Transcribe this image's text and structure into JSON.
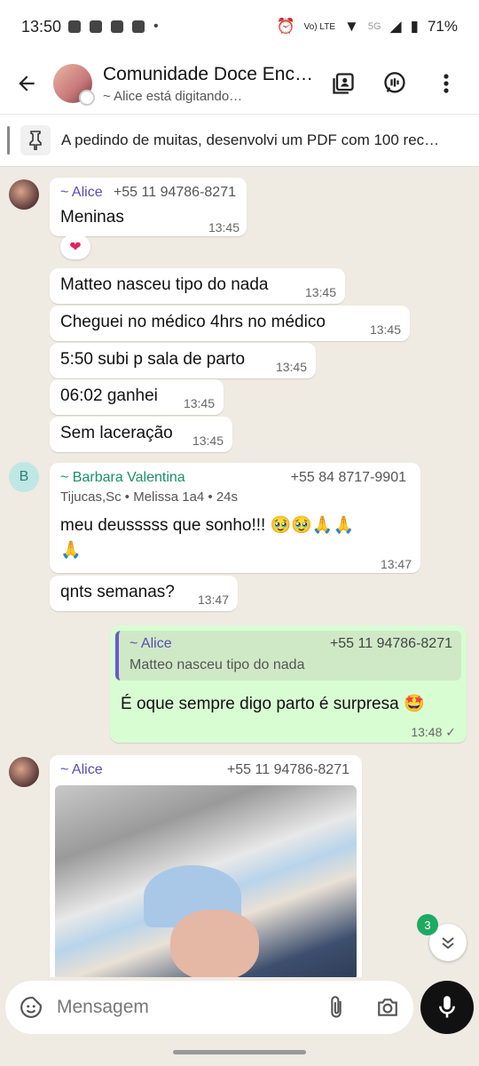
{
  "status": {
    "time": "13:50",
    "battery": "71%",
    "lte": "Vo) LTE",
    "net": "5G"
  },
  "header": {
    "title": "Comunidade Doce Enc…",
    "subtitle": "~ Alice está digitando…"
  },
  "pinned": {
    "text": "A pedindo de muitas, desenvolvi um PDF com 100 rec…"
  },
  "messages": {
    "m1": {
      "sender": "~ Alice",
      "phone": "+55 11 94786-8271",
      "text": "Meninas",
      "time": "13:45",
      "reaction": "❤"
    },
    "m2": {
      "text": "Matteo nasceu tipo do nada",
      "time": "13:45"
    },
    "m3": {
      "text": "Cheguei no médico 4hrs no médico",
      "time": "13:45"
    },
    "m4": {
      "text": "5:50 subi p sala de parto",
      "time": "13:45"
    },
    "m5": {
      "text": "06:02 ganhei",
      "time": "13:45"
    },
    "m6": {
      "text": "Sem laceração",
      "time": "13:45"
    },
    "m7": {
      "avatar_letter": "B",
      "sender": "~ Barbara Valentina",
      "phone": "+55 84 8717-9901",
      "meta": "Tijucas,Sc • Melissa 1a4 • 24s",
      "text1": "meu deusssss que sonho!!! 🥹🥹🙏🙏",
      "text2": "🙏",
      "time": "13:47"
    },
    "m8": {
      "text": "qnts semanas?",
      "time": "13:47"
    },
    "m9": {
      "quote_sender": "~ Alice",
      "quote_phone": "+55 11 94786-8271",
      "quote_text": "Matteo nasceu tipo do nada",
      "text": "É oque sempre digo parto é surpresa 🤩",
      "time": "13:48 ✓"
    },
    "m10": {
      "sender": "~ Alice",
      "phone": "+55 11 94786-8271"
    }
  },
  "scroll": {
    "unread": "3"
  },
  "input": {
    "placeholder": "Mensagem"
  },
  "colors": {
    "alice": "#5b4bb5",
    "barbara": "#1a8f6a",
    "outgoing": "#d9fdd3",
    "chat_bg": "#efeae2"
  }
}
